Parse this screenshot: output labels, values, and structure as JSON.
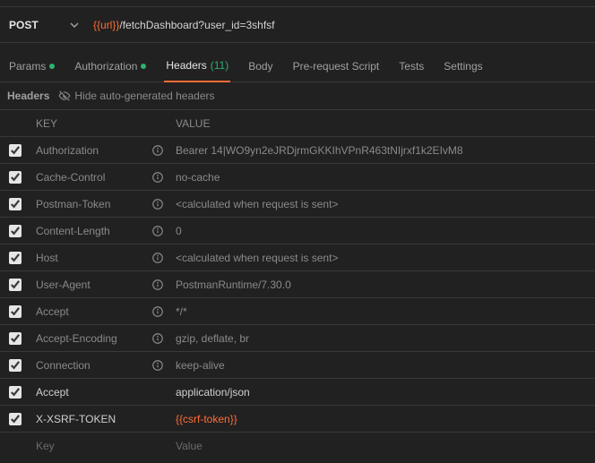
{
  "request": {
    "method": "POST",
    "url_var": "{{url}}",
    "url_rest": "/fetchDashboard?user_id=3shfsf"
  },
  "tabs": {
    "params": "Params",
    "authorization": "Authorization",
    "headers": "Headers",
    "headers_count": "(11)",
    "body": "Body",
    "prerequest": "Pre-request Script",
    "tests": "Tests",
    "settings": "Settings"
  },
  "subbar": {
    "label": "Headers",
    "hide": "Hide auto-generated headers"
  },
  "columns": {
    "key": "KEY",
    "value": "VALUE"
  },
  "rows": [
    {
      "checked": true,
      "auto": true,
      "key": "Authorization",
      "value": "Bearer 14|WO9yn2eJRDjrmGKKIhVPnR463tNIjrxf1k2EIvM8"
    },
    {
      "checked": true,
      "auto": true,
      "key": "Cache-Control",
      "value": "no-cache"
    },
    {
      "checked": true,
      "auto": true,
      "key": "Postman-Token",
      "value": "<calculated when request is sent>"
    },
    {
      "checked": true,
      "auto": true,
      "key": "Content-Length",
      "value": "0"
    },
    {
      "checked": true,
      "auto": true,
      "key": "Host",
      "value": "<calculated when request is sent>"
    },
    {
      "checked": true,
      "auto": true,
      "key": "User-Agent",
      "value": "PostmanRuntime/7.30.0"
    },
    {
      "checked": true,
      "auto": true,
      "key": "Accept",
      "value": "*/*"
    },
    {
      "checked": true,
      "auto": true,
      "key": "Accept-Encoding",
      "value": "gzip, deflate, br"
    },
    {
      "checked": true,
      "auto": true,
      "key": "Connection",
      "value": "keep-alive"
    },
    {
      "checked": true,
      "auto": false,
      "key": "Accept",
      "value": "application/json"
    },
    {
      "checked": true,
      "auto": false,
      "key": "X-XSRF-TOKEN",
      "value": "{{csrf-token}}",
      "is_var": true
    }
  ],
  "new_row": {
    "key_placeholder": "Key",
    "value_placeholder": "Value"
  }
}
